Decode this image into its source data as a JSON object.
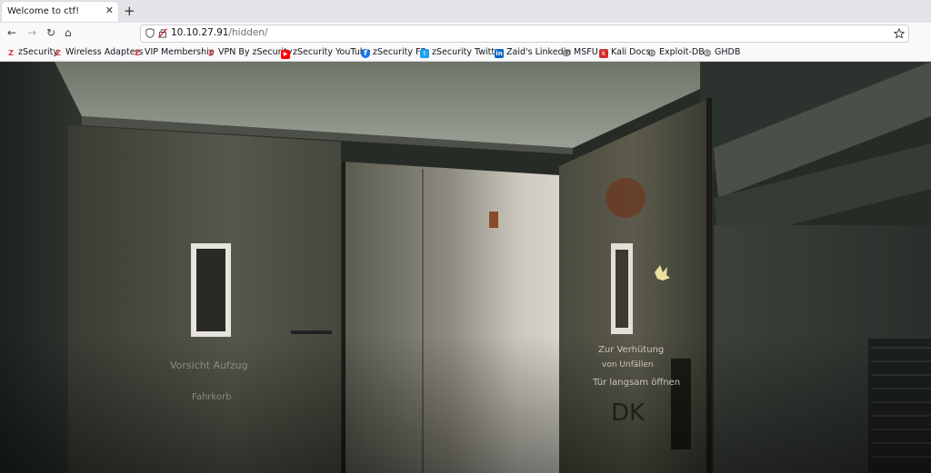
{
  "tab": {
    "title": "Welcome to ctf!",
    "close": "✕",
    "new": "+"
  },
  "nav": {
    "back": "←",
    "forward": "→",
    "reload": "↻",
    "home": "⌂"
  },
  "url": {
    "host": "10.10.27.91",
    "path": "/hidden/"
  },
  "bookmarks": [
    {
      "label": "zSecurity",
      "icon": "z-logo-icon",
      "color": "#e03c3c"
    },
    {
      "label": "Wireless Adapters",
      "icon": "z-logo-icon",
      "color": "#e03c3c"
    },
    {
      "label": "VIP Membership",
      "icon": "z-logo-icon",
      "color": "#e03c3c"
    },
    {
      "label": "VPN By zSecurity",
      "icon": "z-logo-icon",
      "color": "#e03c3c"
    },
    {
      "label": "zSecurity YouTube",
      "icon": "youtube-icon",
      "color": "#ff0000"
    },
    {
      "label": "zSecurity FB",
      "icon": "facebook-icon",
      "color": "#1877f2"
    },
    {
      "label": "zSecurity Twitter",
      "icon": "twitter-icon",
      "color": "#1da1f2"
    },
    {
      "label": "Zaid's Linkedin",
      "icon": "linkedin-icon",
      "color": "#0a66c2"
    },
    {
      "label": "MSFU",
      "icon": "globe-icon",
      "color": "#444444"
    },
    {
      "label": "Kali Docs",
      "icon": "kali-icon",
      "color": "#d22b2b"
    },
    {
      "label": "Exploit-DB",
      "icon": "globe-icon",
      "color": "#444444"
    },
    {
      "label": "GHDB",
      "icon": "globe-icon",
      "color": "#444444"
    }
  ],
  "image": {
    "left_sign_1": "Vorsicht Aufzug",
    "left_sign_2": "Fahrkorb",
    "right_sign_1": "Zur Verhütung",
    "right_sign_2": "von Unfällen",
    "right_sign_3": "Tür langsam öffnen",
    "graffiti": "DK"
  }
}
